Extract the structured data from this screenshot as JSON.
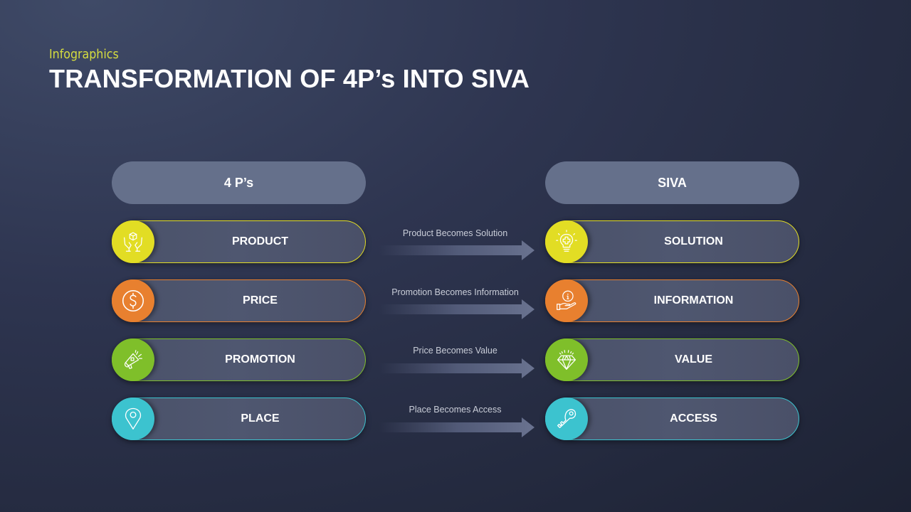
{
  "header": {
    "subtitle": "Infographics",
    "title": "TRANSFORMATION OF 4P’s INTO SIVA"
  },
  "columns": {
    "left_header": "4 P’s",
    "right_header": "SIVA"
  },
  "rows": [
    {
      "left": {
        "label": "PRODUCT",
        "icon": "hands-box-icon"
      },
      "transition": "Product Becomes Solution",
      "right": {
        "label": "SOLUTION",
        "icon": "lightbulb-icon"
      },
      "color": "#e2dd24"
    },
    {
      "left": {
        "label": "PRICE",
        "icon": "dollar-coin-icon"
      },
      "transition": "Promotion Becomes Information",
      "right": {
        "label": "INFORMATION",
        "icon": "info-hand-icon"
      },
      "color": "#e8802f"
    },
    {
      "left": {
        "label": "PROMOTION",
        "icon": "megaphone-icon"
      },
      "transition": "Price Becomes Value",
      "right": {
        "label": "VALUE",
        "icon": "diamond-icon"
      },
      "color": "#7fbf2a"
    },
    {
      "left": {
        "label": "PLACE",
        "icon": "map-pin-icon"
      },
      "transition": "Place Becomes Access",
      "right": {
        "label": "ACCESS",
        "icon": "key-icon"
      },
      "color": "#3cc3cf"
    }
  ],
  "colors": {
    "accent_subtitle": "#d6dd3f",
    "header_pill": "#65708b",
    "row_pill": "#4c536b"
  }
}
